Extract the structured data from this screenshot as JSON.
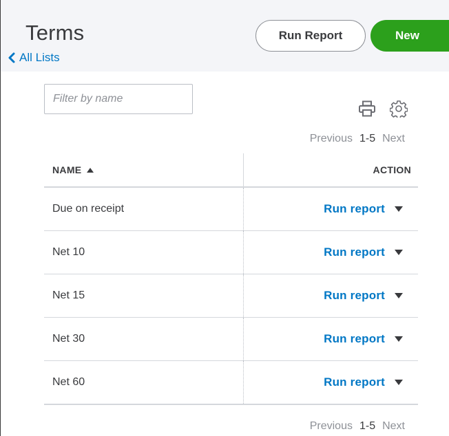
{
  "header": {
    "title": "Terms",
    "back_link": "All Lists",
    "run_report_label": "Run Report",
    "new_label": "New"
  },
  "filter": {
    "placeholder": "Filter by name"
  },
  "icons": {
    "print": "printer-icon",
    "settings": "gear-icon"
  },
  "pager": {
    "previous": "Previous",
    "range": "1-5",
    "next": "Next"
  },
  "table": {
    "columns": [
      "NAME",
      "ACTION"
    ],
    "sort": "NAME ascending",
    "rows": [
      {
        "name": "Due on receipt",
        "action": "Run report"
      },
      {
        "name": "Net 10",
        "action": "Run report"
      },
      {
        "name": "Net 15",
        "action": "Run report"
      },
      {
        "name": "Net 30",
        "action": "Run report"
      },
      {
        "name": "Net 60",
        "action": "Run report"
      }
    ]
  },
  "colors": {
    "accent_green": "#2ca01c",
    "link_blue": "#0077c5",
    "header_bg": "#f4f5f8",
    "text": "#393a3d",
    "muted": "#8d9096"
  }
}
